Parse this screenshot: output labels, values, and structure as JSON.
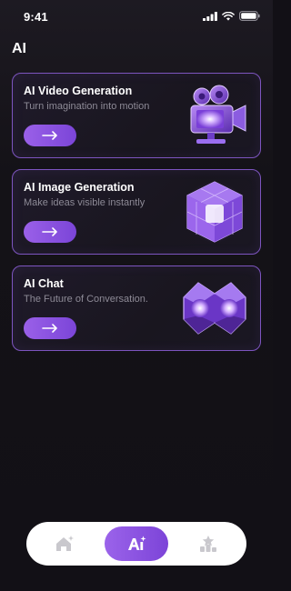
{
  "status_bar": {
    "time": "9:41"
  },
  "header": {
    "title": "AI"
  },
  "cards": [
    {
      "title": "AI Video Generation",
      "subtitle": "Turn imagination into motion",
      "art_icon": "camera-icon"
    },
    {
      "title": "AI Image Generation",
      "subtitle": "Make ideas visible instantly",
      "art_icon": "cube-icon"
    },
    {
      "title": "AI Chat",
      "subtitle": "The Future of Conversation.",
      "art_icon": "chat-icon"
    }
  ],
  "bottom_nav": {
    "items": [
      {
        "icon": "home-sparkle-icon",
        "active": false
      },
      {
        "icon": "ai-sparkle-icon",
        "active": true
      },
      {
        "icon": "ranking-icon",
        "active": false
      }
    ]
  },
  "colors": {
    "accent": "#8a55e0",
    "card_border": "#7d55bf",
    "background": "#121016",
    "nav_background": "#ffffff",
    "subtitle": "#8d8a96"
  }
}
